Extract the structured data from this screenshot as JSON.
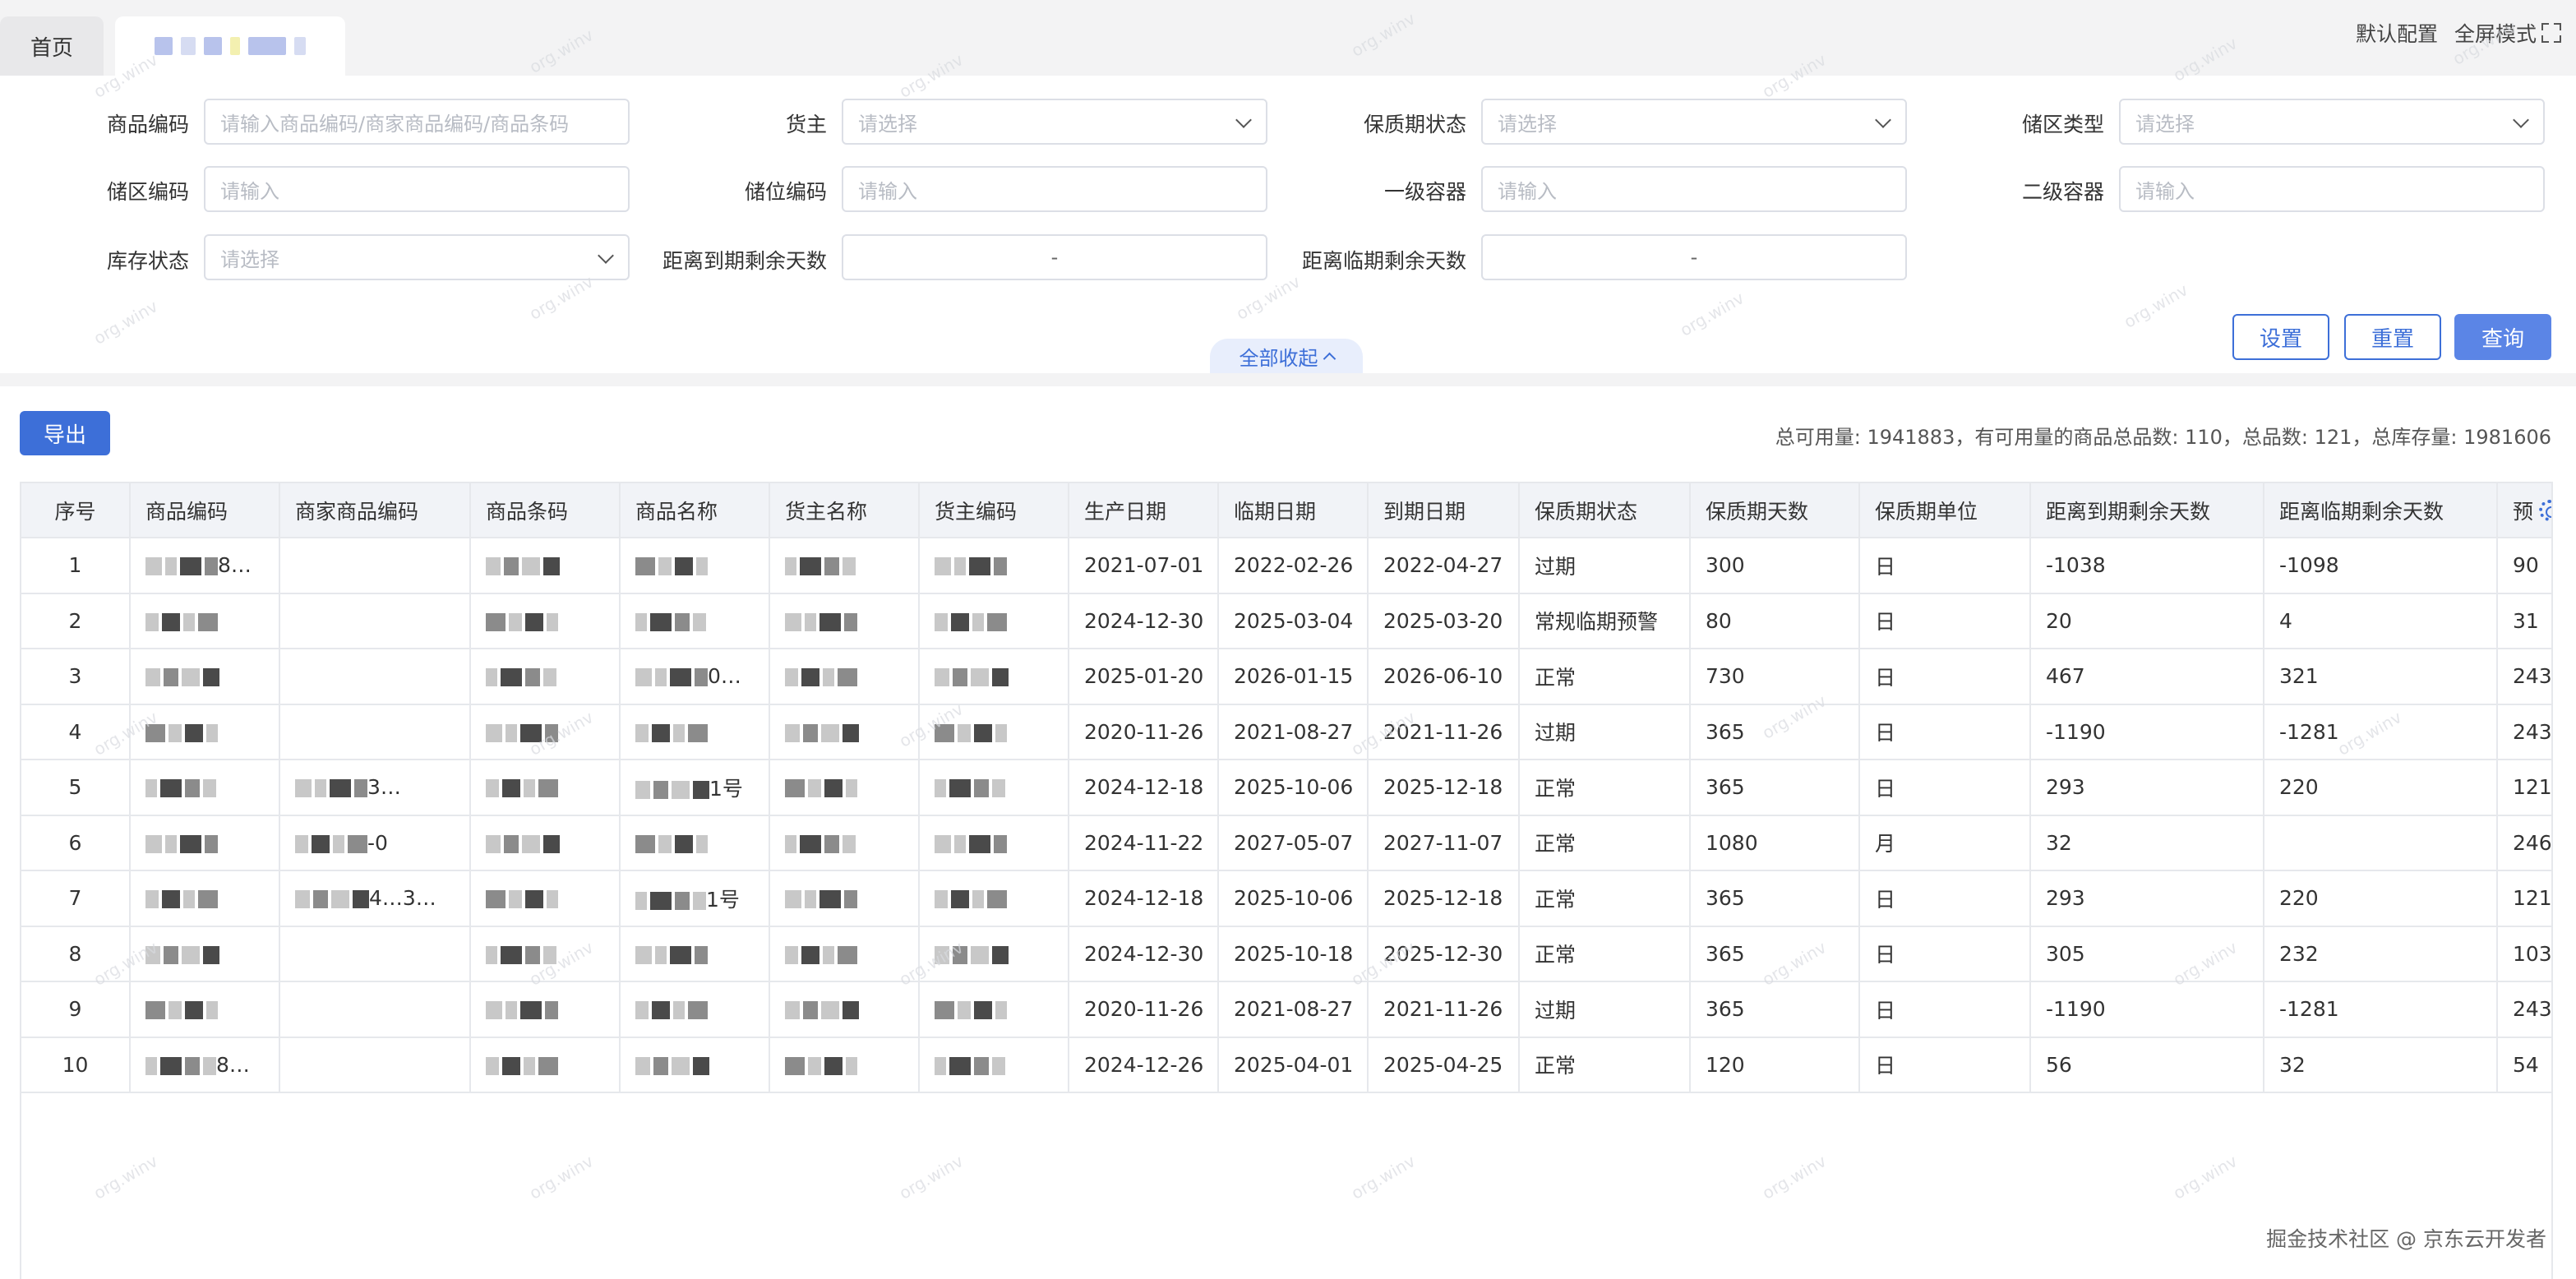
{
  "tabs": [
    {
      "label": "首页"
    },
    {
      "label": ""
    }
  ],
  "top_actions": {
    "default_config": "默认配置",
    "fullscreen": "全屏模式"
  },
  "filters": {
    "sku_code": {
      "label": "商品编码",
      "placeholder": "请输入商品编码/商家商品编码/商品条码"
    },
    "owner": {
      "label": "货主",
      "placeholder": "请选择"
    },
    "shelf_status": {
      "label": "保质期状态",
      "placeholder": "请选择"
    },
    "zone_type": {
      "label": "储区类型",
      "placeholder": "请选择"
    },
    "zone_code": {
      "label": "储区编码",
      "placeholder": "请输入"
    },
    "location_code": {
      "label": "储位编码",
      "placeholder": "请输入"
    },
    "container1": {
      "label": "一级容器",
      "placeholder": "请输入"
    },
    "container2": {
      "label": "二级容器",
      "placeholder": "请输入"
    },
    "stock_status": {
      "label": "库存状态",
      "placeholder": "请选择"
    },
    "days_to_expiry": {
      "label": "距离到期剩余天数",
      "separator": "-"
    },
    "days_to_near_expiry": {
      "label": "距离临期剩余天数",
      "separator": "-"
    }
  },
  "buttons": {
    "settings": "设置",
    "reset": "重置",
    "query": "查询",
    "collapse": "全部收起",
    "export": "导出"
  },
  "summary": "总可用量: 1941883，有可用量的商品总品数: 110，总品数: 121，总库存量: 1981606",
  "table": {
    "headers": [
      "序号",
      "商品编码",
      "商家商品编码",
      "商品条码",
      "商品名称",
      "货主名称",
      "货主编码",
      "生产日期",
      "临期日期",
      "到期日期",
      "保质期状态",
      "保质期天数",
      "保质期单位",
      "距离到期剩余天数",
      "距离临期剩余天数",
      "预"
    ],
    "rows": [
      {
        "no": "1",
        "sku_suffix": "8…",
        "merchant_code": "",
        "name_suffix": "",
        "prod": "2021-07-01",
        "near": "2022-02-26",
        "expire": "2022-04-27",
        "status": "过期",
        "days": "300",
        "unit": "日",
        "to_expire": "-1038",
        "to_near": "-1098",
        "extra": "90"
      },
      {
        "no": "2",
        "sku_suffix": "",
        "merchant_code": "",
        "name_suffix": "",
        "prod": "2024-12-30",
        "near": "2025-03-04",
        "expire": "2025-03-20",
        "status": "常规临期预警",
        "days": "80",
        "unit": "日",
        "to_expire": "20",
        "to_near": "4",
        "extra": "31"
      },
      {
        "no": "3",
        "sku_suffix": "",
        "merchant_code": "",
        "name_suffix": "0…",
        "prod": "2025-01-20",
        "near": "2026-01-15",
        "expire": "2026-06-10",
        "status": "正常",
        "days": "730",
        "unit": "日",
        "to_expire": "467",
        "to_near": "321",
        "extra": "243"
      },
      {
        "no": "4",
        "sku_suffix": "",
        "merchant_code": "",
        "name_suffix": "",
        "prod": "2020-11-26",
        "near": "2021-08-27",
        "expire": "2021-11-26",
        "status": "过期",
        "days": "365",
        "unit": "日",
        "to_expire": "-1190",
        "to_near": "-1281",
        "extra": "243"
      },
      {
        "no": "5",
        "sku_suffix": "",
        "merchant_code": "3…",
        "name_suffix": "1号",
        "prod": "2024-12-18",
        "near": "2025-10-06",
        "expire": "2025-12-18",
        "status": "正常",
        "days": "365",
        "unit": "日",
        "to_expire": "293",
        "to_near": "220",
        "extra": "121"
      },
      {
        "no": "6",
        "sku_suffix": "",
        "merchant_code": "-0",
        "name_suffix": "",
        "prod": "2024-11-22",
        "near": "2027-05-07",
        "expire": "2027-11-07",
        "status": "正常",
        "days": "1080",
        "unit": "月",
        "to_expire": "32",
        "to_near": "",
        "extra": "246"
      },
      {
        "no": "7",
        "sku_suffix": "",
        "merchant_code": "4…3…",
        "name_suffix": "1号",
        "prod": "2024-12-18",
        "near": "2025-10-06",
        "expire": "2025-12-18",
        "status": "正常",
        "days": "365",
        "unit": "日",
        "to_expire": "293",
        "to_near": "220",
        "extra": "121"
      },
      {
        "no": "8",
        "sku_suffix": "",
        "merchant_code": "",
        "name_suffix": "",
        "prod": "2024-12-30",
        "near": "2025-10-18",
        "expire": "2025-12-30",
        "status": "正常",
        "days": "365",
        "unit": "日",
        "to_expire": "305",
        "to_near": "232",
        "extra": "103"
      },
      {
        "no": "9",
        "sku_suffix": "",
        "merchant_code": "",
        "name_suffix": "",
        "prod": "2020-11-26",
        "near": "2021-08-27",
        "expire": "2021-11-26",
        "status": "过期",
        "days": "365",
        "unit": "日",
        "to_expire": "-1190",
        "to_near": "-1281",
        "extra": "243"
      },
      {
        "no": "10",
        "sku_suffix": "8…",
        "merchant_code": "",
        "name_suffix": "",
        "prod": "2024-12-26",
        "near": "2025-04-01",
        "expire": "2025-04-25",
        "status": "正常",
        "days": "120",
        "unit": "日",
        "to_expire": "56",
        "to_near": "32",
        "extra": "54"
      }
    ]
  },
  "watermark_text": "org.winv",
  "footer": "掘金技术社区 @ 京东云开发者",
  "colors": {
    "primary": "#3d6fd8",
    "primary_light": "#5b85e6",
    "header_bg": "#f1f3f7",
    "border": "#e6e8ec"
  }
}
